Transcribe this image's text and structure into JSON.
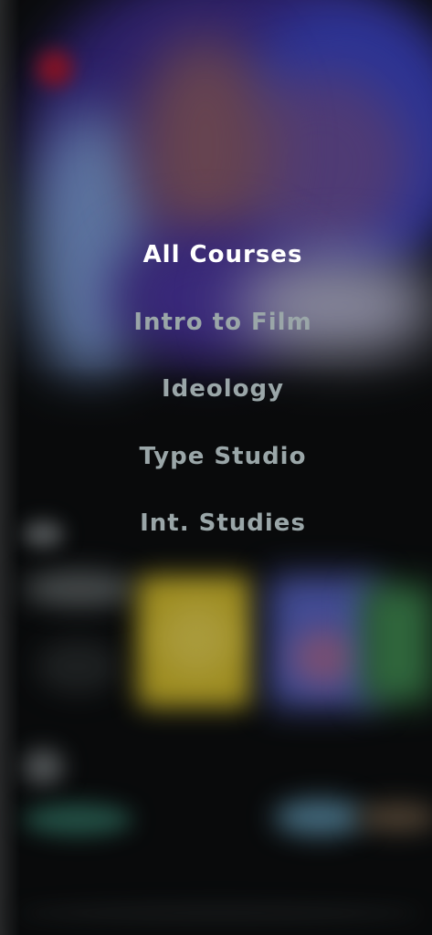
{
  "menu": {
    "items": [
      {
        "label": "All Courses",
        "active": true
      },
      {
        "label": "Intro to Film",
        "active": false
      },
      {
        "label": "Ideology",
        "active": false
      },
      {
        "label": "Type Studio",
        "active": false
      },
      {
        "label": "Int. Studies",
        "active": false
      }
    ]
  },
  "colors": {
    "active_text": "#ffffff",
    "inactive_text": "#9aa6a8",
    "background": "#0a0c0c"
  }
}
